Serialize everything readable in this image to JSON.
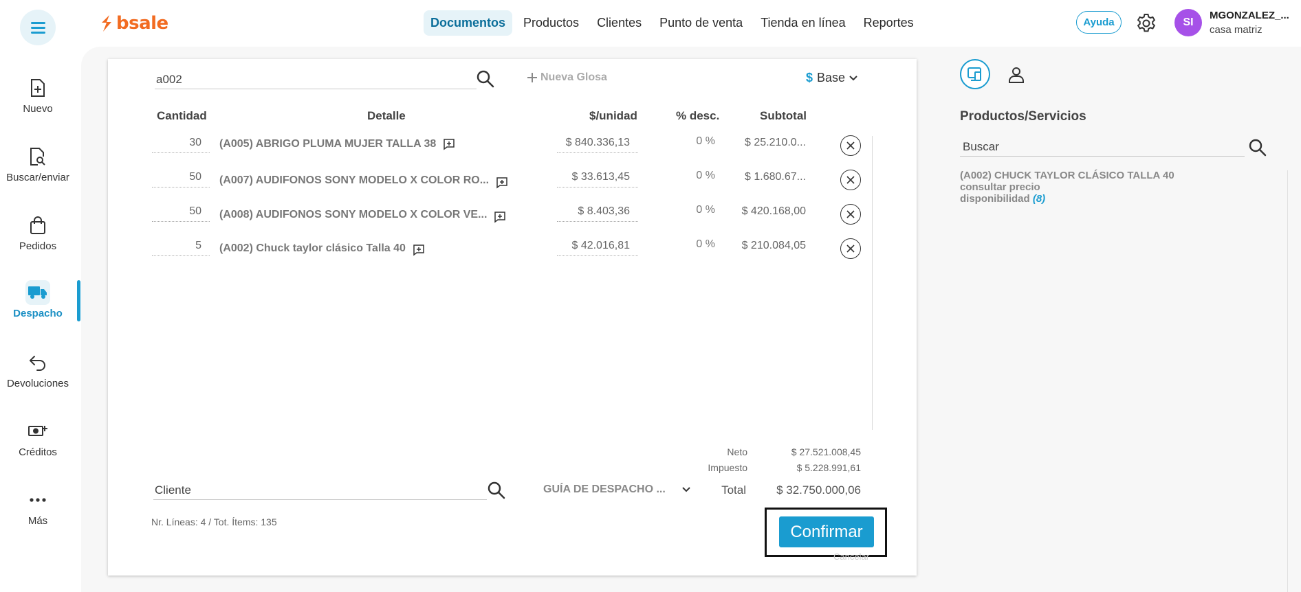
{
  "header": {
    "logo_text": "bsale",
    "nav": [
      "Documentos",
      "Productos",
      "Clientes",
      "Punto de venta",
      "Tienda en línea",
      "Reportes"
    ],
    "active_nav": 0,
    "help_label": "Ayuda",
    "user": {
      "initials": "SI",
      "name": "MGONZALEZ_...",
      "branch": "casa matriz"
    }
  },
  "sidebar": {
    "items": [
      {
        "label": "Nuevo",
        "icon": "new-document-icon"
      },
      {
        "label": "Buscar/enviar",
        "icon": "search-document-icon"
      },
      {
        "label": "Pedidos",
        "icon": "shopping-bag-icon"
      },
      {
        "label": "Despacho",
        "icon": "truck-icon"
      },
      {
        "label": "Devoluciones",
        "icon": "return-arrow-icon"
      },
      {
        "label": "Créditos",
        "icon": "money-plus-icon"
      },
      {
        "label": "Más",
        "icon": "more-dots-icon"
      }
    ],
    "active": 3
  },
  "document": {
    "product_search_value": "a002",
    "new_gloss_label": "Nueva Glosa",
    "currency_symbol": "$",
    "currency_label": "Base",
    "columns": {
      "qty": "Cantidad",
      "detail": "Detalle",
      "unit_price": "$/unidad",
      "discount": "% desc.",
      "subtotal": "Subtotal"
    },
    "rows": [
      {
        "qty": "30",
        "detail": "(A005) ABRIGO PLUMA MUJER TALLA 38",
        "unit_price": "$ 840.336,13",
        "discount": "0 %",
        "subtotal": "$ 25.210.0..."
      },
      {
        "qty": "50",
        "detail": "(A007) AUDIFONOS SONY MODELO X COLOR RO...",
        "unit_price": "$ 33.613,45",
        "discount": "0 %",
        "subtotal": "$ 1.680.67..."
      },
      {
        "qty": "50",
        "detail": "(A008) AUDIFONOS SONY MODELO X COLOR VE...",
        "unit_price": "$ 8.403,36",
        "discount": "0 %",
        "subtotal": "$ 420.168,00"
      },
      {
        "qty": "5",
        "detail": "(A002) Chuck taylor clásico Talla 40",
        "unit_price": "$ 42.016,81",
        "discount": "0 %",
        "subtotal": "$ 210.084,05"
      }
    ],
    "totals": {
      "neto_label": "Neto",
      "neto_value": "$ 27.521.008,45",
      "tax_label": "Impuesto",
      "tax_value": "$ 5.228.991,61",
      "total_label": "Total",
      "total_value": "$ 32.750.000,06"
    },
    "client_placeholder": "Cliente",
    "doc_type": "GUÍA DE DESPACHO ...",
    "summary": "Nr. Líneas: 4 / Tot. Ítems: 135",
    "confirm_label": "Confirmar",
    "cancel_label": "Cancelar"
  },
  "right_panel": {
    "title": "Productos/Servicios",
    "search_placeholder": "Buscar",
    "result": {
      "name": "(A002) CHUCK TAYLOR CLÁSICO TALLA 40",
      "price_note": "consultar precio",
      "availability_label": "disponibilidad",
      "availability_count": "(8)"
    }
  },
  "colors": {
    "accent": "#1a9cd0",
    "brand": "#f26b21",
    "avatar": "#a651e8"
  }
}
